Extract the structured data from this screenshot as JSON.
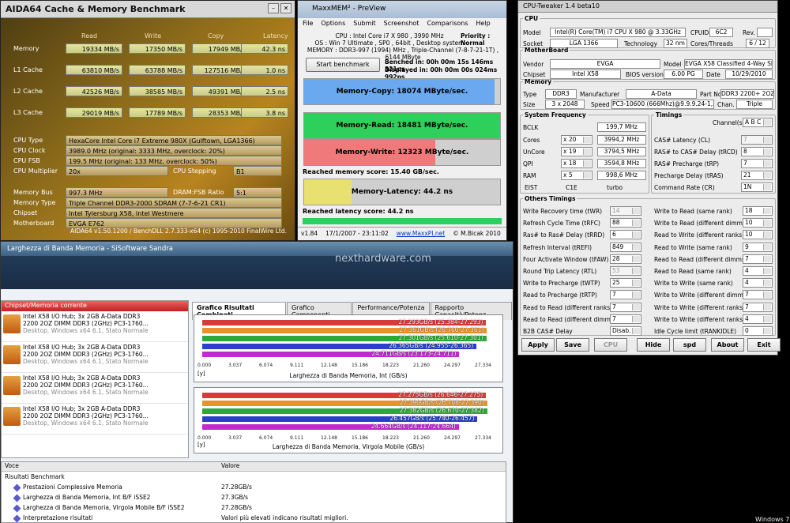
{
  "aida": {
    "title": "AIDA64 Cache & Memory Benchmark",
    "cols": [
      "Read",
      "Write",
      "Copy",
      "Latency"
    ],
    "rows": [
      {
        "label": "Memory",
        "read": "19334 MB/s",
        "write": "17350 MB/s",
        "copy": "17949 MB/s",
        "latency": "42.3 ns"
      },
      {
        "label": "L1 Cache",
        "read": "63810 MB/s",
        "write": "63788 MB/s",
        "copy": "127516 MB/s",
        "latency": "1.0 ns"
      },
      {
        "label": "L2 Cache",
        "read": "42526 MB/s",
        "write": "38585 MB/s",
        "copy": "49391 MB/s",
        "latency": "2.5 ns"
      },
      {
        "label": "L3 Cache",
        "read": "29019 MB/s",
        "write": "17789 MB/s",
        "copy": "28353 MB/s",
        "latency": "3.8 ns"
      }
    ],
    "cpu_type_label": "CPU Type",
    "cpu_type": "HexaCore Intel Core i7 Extreme 980X (Gulftown, LGA1366)",
    "cpu_clock_label": "CPU Clock",
    "cpu_clock": "3989.0 MHz (original: 3333 MHz, overclock: 20%)",
    "cpu_fsb_label": "CPU FSB",
    "cpu_fsb": "199.5 MHz (original: 133 MHz, overclock: 50%)",
    "cpu_mult_label": "CPU Multiplier",
    "cpu_mult": "20x",
    "cpu_step_label": "CPU Stepping",
    "cpu_step": "B1",
    "mem_bus_label": "Memory Bus",
    "mem_bus": "997.3 MHz",
    "dram_ratio_label": "DRAM:FSB Ratio",
    "dram_ratio": "5:1",
    "mem_type_label": "Memory Type",
    "mem_type": "Triple Channel DDR3-2000 SDRAM (7-7-6-21 CR1)",
    "chipset_label": "Chipset",
    "chipset": "Intel Tylersburg X58, Intel Westmere",
    "mobo_label": "Motherboard",
    "mobo": "EVGA E762",
    "footer": "AIDA64 v1.50.1200 / BenchDLL 2.7.333-x64  (c) 1995-2010 FinalWire Ltd."
  },
  "maxx": {
    "title": "MaxxMEM² - PreView",
    "menu": [
      "File",
      "Options",
      "Submit",
      "Screenshot",
      "Comparisons",
      "Help"
    ],
    "cpu_line": "CPU : Intel Core i7 X 980 , 3990 MHz",
    "priority": "Priority : Normal",
    "os_line": "OS : Win 7 Ultimate , SP0 , 64bit , Desktop system",
    "mem_line": "MEMORY : DDR3-997 (1994) MHz , Triple-Channel (7-8-7-21-1T) , 6144 MByte",
    "start_btn": "Start benchmark",
    "benched": "Benched in: 00h 00m 15s 146ms 321ps",
    "displayed": "Displayed in: 00h 00m 00s 024ms 992ps",
    "copy_label": "Memory-Copy: 18074 MByte/sec.",
    "read_label": "Memory-Read: 18481 MByte/sec.",
    "write_label": "Memory-Write: 12323 MByte/sec.",
    "mem_score": "Reached memory score: 15.40 GB/sec.",
    "lat_label": "Memory-Latency: 44.2 ns",
    "lat_score": "Reached latency score: 44.2 ns",
    "version": "v1.84",
    "date": "17/1/2007 - 23:11:02",
    "url": "www.MaxxPI.net",
    "copyright": "© M.Bicak 2010",
    "fills": {
      "copy": 0.97,
      "read": 1.0,
      "write": 0.67,
      "latency": 0.24
    },
    "colors": {
      "copy": "#6aa8f0",
      "read": "#2ecf5a",
      "write": "#f07a7a",
      "latency": "#e8e070"
    }
  },
  "tweak": {
    "title": "CPU-Tweaker 1.4 beta10",
    "cpu_legend": "CPU",
    "model_l": "Model",
    "model": "Intel(R) Core(TM) i7 CPU    X 980  @ 3.33GHz",
    "cpuid_l": "CPUID",
    "cpuid": "6C2",
    "rev_l": "Rev.",
    "socket_l": "Socket",
    "socket": "LGA 1366",
    "tech_l": "Technology",
    "tech": "32 nm",
    "cores_l": "Cores/Threads",
    "cores": "6 / 12",
    "mb_legend": "MotherBoard",
    "vendor_l": "Vendor",
    "vendor": "EVGA",
    "mbmodel_l": "Model",
    "mbmodel": "EVGA X58 Classified 4-Way SLI",
    "chip_l": "Chipset",
    "chip": "Intel X58",
    "bios_l": "BIOS version",
    "bios": "6.00 PG",
    "date_l": "Date",
    "date": "10/29/2010",
    "mem_legend": "Memory",
    "type_l": "Type",
    "type": "DDR3",
    "manu_l": "Manufacturer",
    "manu": "A-Data",
    "part_l": "Part No.",
    "part": "DDR3 2200+ 2OZ",
    "size_l": "Size",
    "size": "3 x 2048",
    "speed_l": "Speed",
    "speed": "PC3-10600 (666Mhz)@9.9.9.24-1,5V",
    "chan_l": "Chan.",
    "chan": "Triple",
    "freq_legend": "System Frequency",
    "bclk_l": "BCLK",
    "bclk": "199,7 MHz",
    "cores2_l": "Cores",
    "cores_mult": "x 20",
    "cores_f": "3994,2 MHz",
    "uncore_l": "UnCore",
    "uncore_mult": "x 19",
    "uncore_f": "3794,5 MHz",
    "qpi_l": "QPI",
    "qpi_mult": "x 18",
    "qpi_f": "3594,8 MHz",
    "ram_l": "RAM",
    "ram_mult": "x 5",
    "ram_f": "998,6 MHz",
    "eist": "EIST",
    "c1e": "C1E",
    "turbo": "turbo",
    "timings_legend": "Timings",
    "channels_l": "Channel(s)",
    "channels": "A  B  C",
    "cas_l": "CAS# Latency (CL)",
    "cas": "7",
    "trcd_l": "RAS# to CAS# Delay (tRCD)",
    "trcd": "8",
    "trp_l": "RAS# Precharge (tRP)",
    "trp": "7",
    "tras_l": "Precharge Delay (tRAS)",
    "tras": "21",
    "cr_l": "Command Rate (CR)",
    "cr": "1N",
    "other_legend": "Others Timings",
    "left": [
      {
        "l": "Write Recovery time (tWR)",
        "v": "14",
        "dis": true
      },
      {
        "l": "Refresh Cycle Time (tRFC)",
        "v": "88"
      },
      {
        "l": "Ras# to Ras# Delay (tRRD)",
        "v": "6"
      },
      {
        "l": "Refresh Interval (tREFI)",
        "v": "849"
      },
      {
        "l": "Four Activate Window (tFAW)",
        "v": "28"
      },
      {
        "l": "Round Trip Latency (RTL)",
        "v": "53",
        "dis": true
      },
      {
        "l": "Write to Precharge (tWTP)",
        "v": "25"
      },
      {
        "l": "Read to Precharge (tRTP)",
        "v": "7"
      },
      {
        "l": "Read to Read (different ranks)",
        "v": "7"
      },
      {
        "l": "Read to Read (different dimms)",
        "v": "7"
      },
      {
        "l": "B2B CAS# Delay",
        "v": "Disab."
      }
    ],
    "right": [
      {
        "l": "Write to Read (same rank)",
        "v": "18"
      },
      {
        "l": "Write to Read (different dimms)",
        "v": "10"
      },
      {
        "l": "Read to Write (different ranks)",
        "v": "10"
      },
      {
        "l": "Read to Write (same rank)",
        "v": "9"
      },
      {
        "l": "Read to Read (different dimms)",
        "v": "7"
      },
      {
        "l": "Read to Read (same rank)",
        "v": "4"
      },
      {
        "l": "Write to Write (same rank)",
        "v": "4"
      },
      {
        "l": "Write to Write (different dimms)",
        "v": "7"
      },
      {
        "l": "Write to Write (different ranks)",
        "v": "7"
      },
      {
        "l": "Write to Write (different ranks)",
        "v": "4"
      },
      {
        "l": "Idle Cycle limit (tRANKIDLE)",
        "v": "0"
      }
    ],
    "buttons": [
      "Apply",
      "Save",
      "CPU",
      "Hide",
      "spd",
      "About",
      "Exit"
    ]
  },
  "sandra": {
    "title": "Larghezza di Banda Memoria - SiSoftware Sandra",
    "left_header": "Chipset/Memoria corrente",
    "items": [
      {
        "l1": "Intel X58 I/O Hub; 3x 2GB A-Data DDR3",
        "l2": "2200 2OZ DIMM DDR3 (2GHz) PC3-1760...",
        "l3": "Desktop, Windows x64 6.1, Stato Normale"
      },
      {
        "l1": "Intel X58 I/O Hub; 3x 2GB A-Data DDR3",
        "l2": "2200 2OZ DIMM DDR3 (2GHz) PC3-1760...",
        "l3": "Desktop, Windows x64 6.1, Stato Normale"
      },
      {
        "l1": "Intel X58 I/O Hub; 3x 2GB A-Data DDR3",
        "l2": "2200 2OZ DIMM DDR3 (2GHz) PC3-1760...",
        "l3": "Desktop, Windows x64 6.1, Stato Normale"
      },
      {
        "l1": "Intel X58 I/O Hub; 3x 2GB A-Data DDR3",
        "l2": "2200 2OZ DIMM DDR3 (2GHz) PC3-1760...",
        "l3": "Desktop, Windows x64 6.1, Stato Normale"
      }
    ],
    "tabs": [
      "Grafico Risultati Combinati",
      "Grafico Componenti",
      "Performance/Potenza",
      "Rapporto Capacità/Potenz"
    ],
    "ticks": [
      "0.000",
      "3.037",
      "6.074",
      "9.111",
      "12.148",
      "15.186",
      "18.223",
      "21.260",
      "24.297",
      "27.334"
    ],
    "chart1_axis": "Larghezza di Banda Memoria, Int (GB/s)",
    "chart2_axis": "Larghezza di Banda Memoria, Virgola Mobile (GB/s)",
    "y": "[y]",
    "chart1": [
      {
        "label": "27.293GB/s (25.384-27.293)",
        "v": 27.293,
        "c": "#d83a3a"
      },
      {
        "label": "27.361GB/s (26.760-27.361)",
        "v": 27.361,
        "c": "#e8922a"
      },
      {
        "label": "27.301GB/s (25.610-27.301)",
        "v": 27.301,
        "c": "#2aa838"
      },
      {
        "label": "26.365GB/s (24.955-26.365)",
        "v": 26.365,
        "c": "#2a40c8"
      },
      {
        "label": "24.711GB/s (23.173-24.711)",
        "v": 24.711,
        "c": "#c02ad0"
      }
    ],
    "chart2": [
      {
        "label": "27.275GB/s (26.646-27.275)",
        "v": 27.275,
        "c": "#d83a3a"
      },
      {
        "label": "27.390GB/s (26.708-27.390)",
        "v": 27.39,
        "c": "#e8922a"
      },
      {
        "label": "27.382GB/s (26.670-27.382)",
        "v": 27.382,
        "c": "#2aa838"
      },
      {
        "label": "26.457GB/s (25.740-26.457)",
        "v": 26.457,
        "c": "#2a40c8"
      },
      {
        "label": "24.664GB/s (24.117-24.664)",
        "v": 24.664,
        "c": "#c02ad0"
      }
    ],
    "col1": "Voce",
    "col2": "Valore",
    "rows": [
      {
        "k": "Risultati Benchmark",
        "v": ""
      },
      {
        "k": "Prestazioni Complessive Memoria",
        "v": "27.28GB/s"
      },
      {
        "k": "Larghezza di Banda Memoria, Int B/F iSSE2",
        "v": "27.3GB/s"
      },
      {
        "k": "Larghezza di Banda Memoria, Virgola Mobile B/F iSSE2",
        "v": "27.28GB/s"
      },
      {
        "k": "Interpretazione risultati",
        "v": "Valori più elevati indicano risultati migliori."
      }
    ]
  },
  "watermark": "nexthardware.com",
  "taskbar": "Windows 7"
}
